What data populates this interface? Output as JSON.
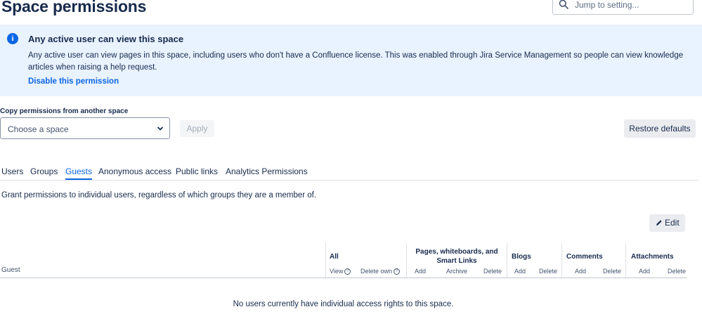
{
  "header": {
    "title": "Space permissions",
    "search_placeholder": "Jump to setting..."
  },
  "banner": {
    "title": "Any active user can view this space",
    "text": "Any active user can view pages in this space, including users who don't have a Confluence license. This was enabled through Jira Service Management so people can view knowledge articles when raising a help request.",
    "link": "Disable this permission",
    "info_icon": "i"
  },
  "copy": {
    "label": "Copy permissions from another space",
    "select_value": "Choose a space",
    "apply_label": "Apply",
    "restore_label": "Restore defaults"
  },
  "tabs": [
    {
      "label": "Users"
    },
    {
      "label": "Groups"
    },
    {
      "label": "Guests"
    },
    {
      "label": "Anonymous access"
    },
    {
      "label": "Public links"
    },
    {
      "label": "Analytics Permissions"
    }
  ],
  "active_tab": "Guests",
  "description": "Grant permissions to individual users, regardless of which groups they are a member of.",
  "edit_label": "Edit",
  "table": {
    "guest_header": "Guest",
    "groups": {
      "all": "All",
      "pages": "Pages, whiteboards, and Smart Links",
      "blogs": "Blogs",
      "comments": "Comments",
      "attachments": "Attachments"
    },
    "sub": {
      "view": "View",
      "delete_own": "Delete own",
      "pages_add": "Add",
      "pages_archive": "Archive",
      "pages_delete": "Delete",
      "blogs_add": "Add",
      "blogs_delete": "Delete",
      "comments_add": "Add",
      "comments_delete": "Delete",
      "attachments_add": "Add",
      "attachments_delete": "Delete"
    },
    "empty_message": "No users currently have individual access rights to this space."
  },
  "colors": {
    "accent": "#0c66e4",
    "banner_bg": "#e9f2ff"
  }
}
